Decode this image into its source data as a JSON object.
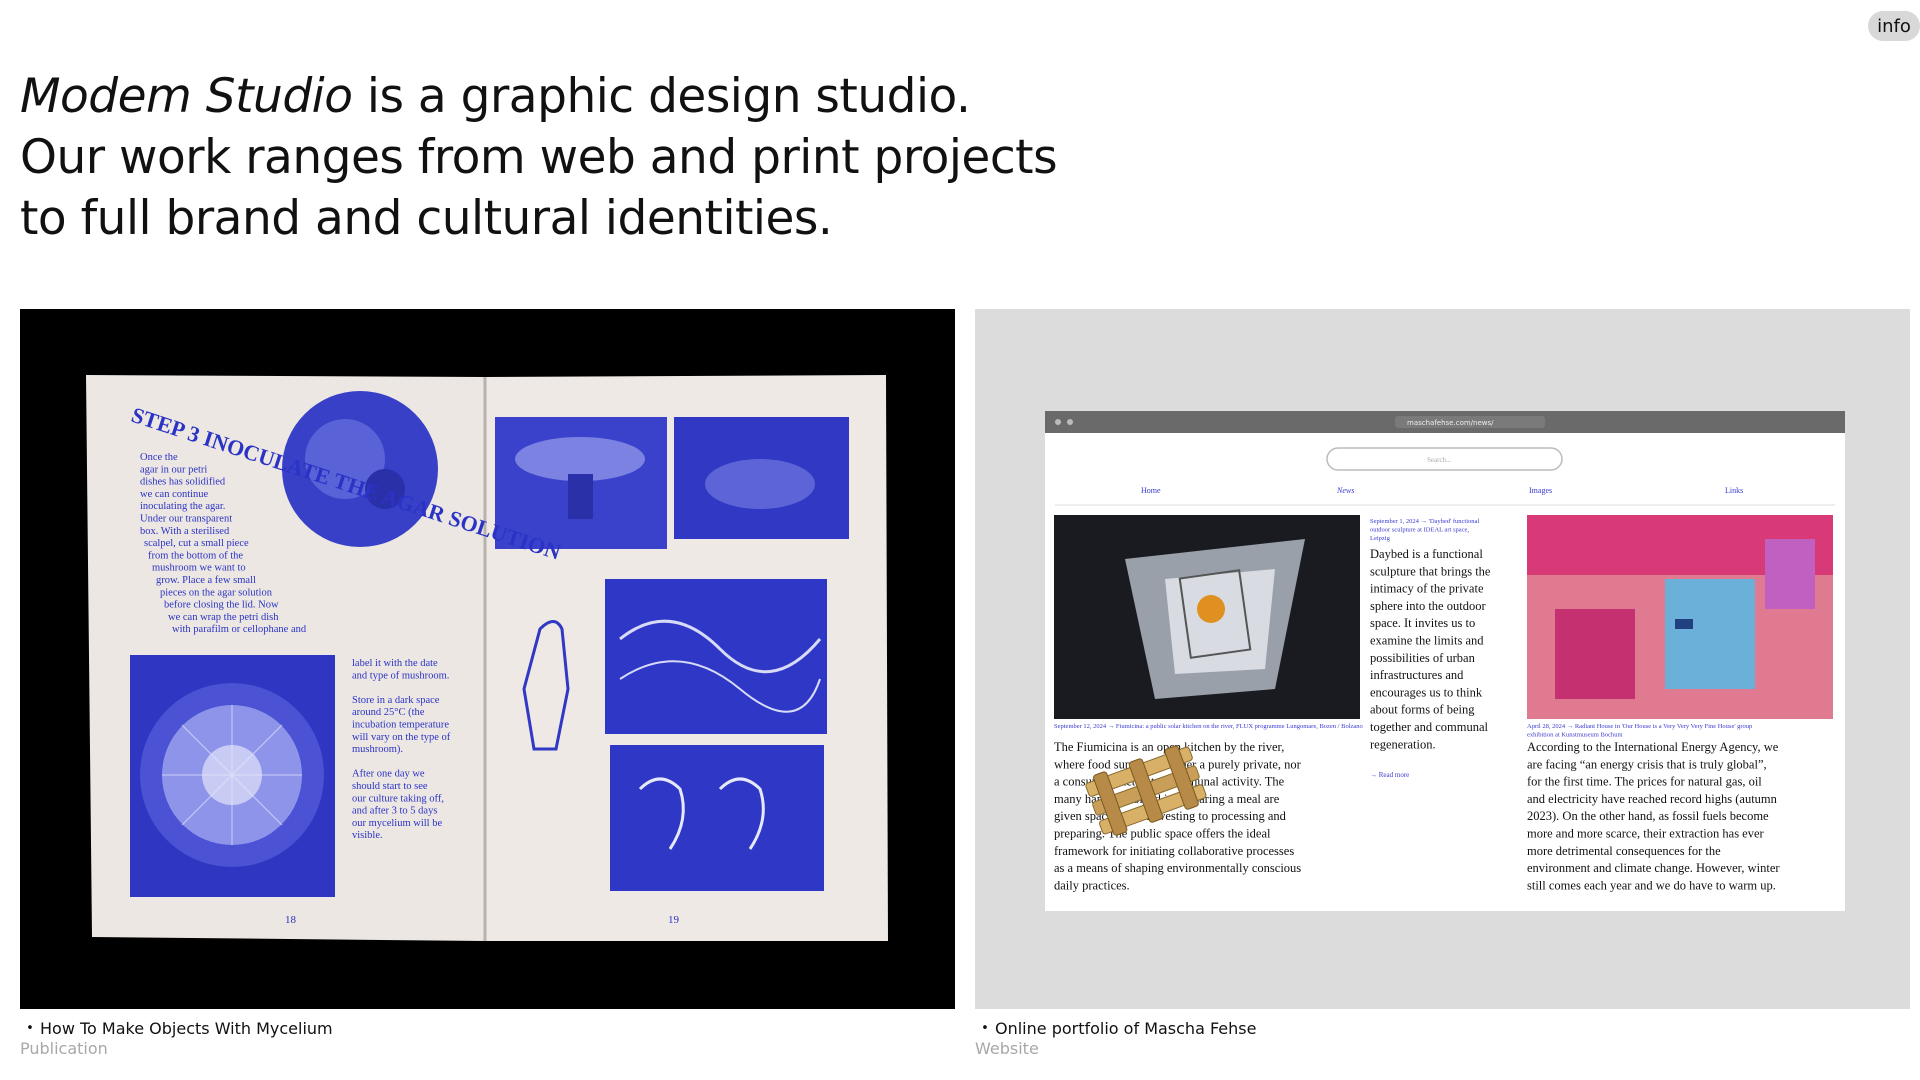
{
  "header": {
    "info_label": "info"
  },
  "intro": {
    "studio_name": "Modem Studio",
    "line1_rest": " is a graphic design studio.",
    "line2": "Our work ranges from web and print projects",
    "line3": "to full brand and cultural identities."
  },
  "projects": [
    {
      "title": "How To Make Objects With Mycelium",
      "kind": "Publication",
      "preview": {
        "step_heading": "STEP 3 INOCULATE THE AGAR SOLUTION",
        "left_body": [
          "Once the",
          "agar in our petri",
          "dishes has solidified",
          "we can continue",
          "inoculating the agar.",
          "Under our transparent",
          "box. With a sterilised",
          "scalpel, cut a small piece",
          "from the bottom of the",
          "mushroom we want to",
          "grow. Place a few small",
          "pieces on the agar solution",
          "before closing the lid. Now",
          "we can wrap the petri dish",
          "with parafilm or cellophane and"
        ],
        "right_body": [
          "label it with the date",
          "and type of mushroom.",
          "",
          "Store in a dark space",
          "around 25°C (the",
          "incubation temperature",
          "will vary on the type of",
          "mushroom).",
          "",
          "After one day we",
          "should start to see",
          "our culture taking off,",
          "and after 3 to 5 days",
          "our mycelium will be",
          "visible."
        ],
        "page_left": "18",
        "page_right": "19"
      }
    },
    {
      "title": "Online portfolio of Mascha Fehse",
      "kind": "Website",
      "preview": {
        "url": "maschafehse.com/news/",
        "search_placeholder": "Search...",
        "nav": [
          "Home",
          "News",
          "Images",
          "Links"
        ],
        "col1_meta": "September 12, 2024 → Fiumicina: a public solar kitchen on the river, FLUX programme Lungomare, Bozen / Bolzano",
        "col1_text": [
          "The Fiumicina is an open kitchen by the river,",
          "where food supply is neither a purely private, nor",
          "a consuming act but a communal activity. The",
          "many hands involved in preparing a meal are",
          "given space from harvesting to processing and",
          "preparing. The public space offers the ideal",
          "framework for initiating collaborative processes",
          "as a means of shaping environmentally conscious",
          "daily practices."
        ],
        "col2_meta": [
          "September 1, 2024 → 'Daybed' functional",
          "outdoor sculpture at IDEAL art space,",
          "Leipzig"
        ],
        "col2_text": [
          "Daybed is a functional",
          "sculpture that brings the",
          "intimacy of the private",
          "sphere into the outdoor",
          "space. It invites us to",
          "examine the limits and",
          "possibilities of urban",
          "infrastructures and",
          "encourages us to think",
          "about forms of being",
          "together and communal",
          "regeneration."
        ],
        "col2_link": "→ Read more",
        "col3_meta": [
          "April 28, 2024 → Radiant House in 'Our House is a Very Very Very Fine House' group",
          "exhibition at Kunstmuseum Bochum"
        ],
        "col3_text": [
          "According to the International Energy Agency, we",
          "are facing “an energy crisis that is truly global”,",
          "for the first time. The prices for natural gas, oil",
          "and electricity have reached record highs (autumn",
          "2023). On the other hand, as fossil fuels become",
          "more and more scarce, their extraction has ever",
          "more detrimental consequences for the",
          "environment and climate change. However, winter",
          "still comes each year and we do have to warm up."
        ]
      }
    }
  ]
}
